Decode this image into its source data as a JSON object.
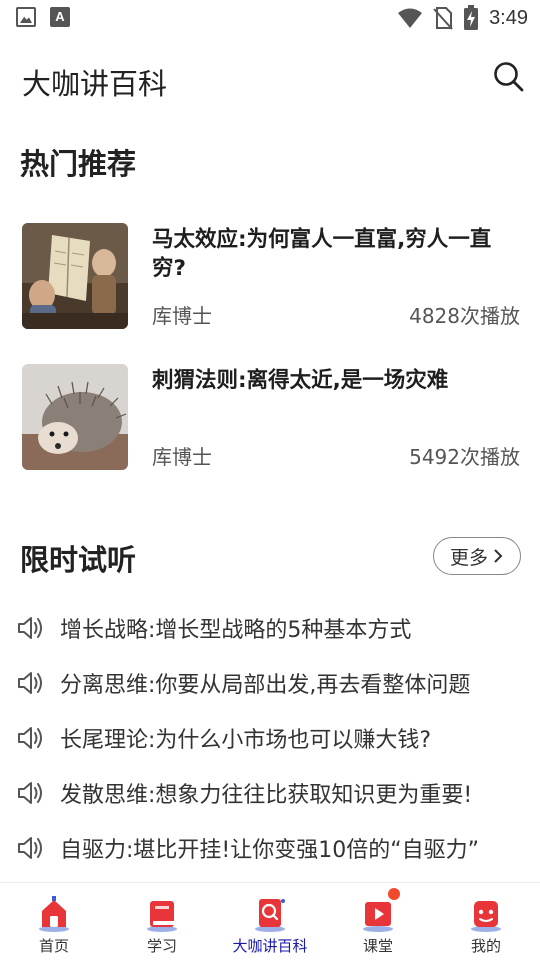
{
  "status_bar": {
    "time": "3:49"
  },
  "header": {
    "title": "大咖讲百科"
  },
  "hot": {
    "title": "热门推荐",
    "items": [
      {
        "title": "马太效应:为何富人一直富,穷人一直穷?",
        "author": "库博士",
        "plays": "4828次播放"
      },
      {
        "title": "刺猬法则:离得太近,是一场灾难",
        "author": "库博士",
        "plays": "5492次播放"
      }
    ]
  },
  "limited": {
    "title": "限时试听",
    "more_label": "更多",
    "items": [
      "增长战略:增长型战略的5种基本方式",
      "分离思维:你要从局部出发,再去看整体问题",
      "长尾理论:为什么小市场也可以赚大钱?",
      "发散思维:想象力往往比获取知识更为重要!",
      "自驱力:堪比开挂!让你变强10倍的“自驱力”"
    ]
  },
  "nav": {
    "items": [
      {
        "label": "首页"
      },
      {
        "label": "学习"
      },
      {
        "label": "大咖讲百科"
      },
      {
        "label": "课堂"
      },
      {
        "label": "我的"
      }
    ],
    "active_index": 2
  },
  "colors": {
    "accent": "#e8353a",
    "active_label": "#1a1aa8",
    "badge": "#f04a2a"
  }
}
